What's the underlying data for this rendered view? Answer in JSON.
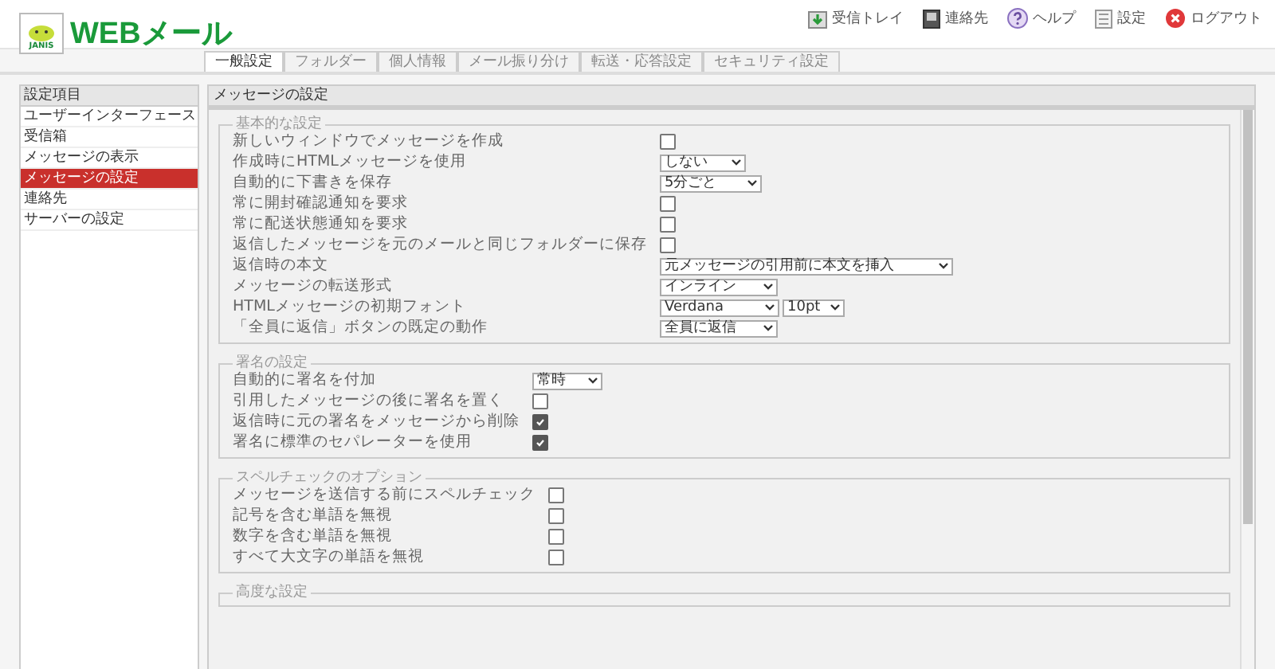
{
  "logo": {
    "badge": "JANIS",
    "title": "WEBメール"
  },
  "toolbar": [
    {
      "kind": "inbox",
      "label": "受信トレイ"
    },
    {
      "kind": "contacts",
      "label": "連絡先"
    },
    {
      "kind": "help",
      "label": "ヘルプ"
    },
    {
      "kind": "settings",
      "label": "設定"
    },
    {
      "kind": "logout",
      "label": "ログアウト"
    }
  ],
  "tabs": [
    {
      "label": "一般設定",
      "selected": true
    },
    {
      "label": "フォルダー",
      "selected": false
    },
    {
      "label": "個人情報",
      "selected": false
    },
    {
      "label": "メール振り分け",
      "selected": false
    },
    {
      "label": "転送・応答設定",
      "selected": false
    },
    {
      "label": "セキュリティ設定",
      "selected": false
    }
  ],
  "sidebar": {
    "title": "設定項目",
    "items": [
      {
        "label": "ユーザーインターフェース",
        "selected": false
      },
      {
        "label": "受信箱",
        "selected": false
      },
      {
        "label": "メッセージの表示",
        "selected": false
      },
      {
        "label": "メッセージの設定",
        "selected": true
      },
      {
        "label": "連絡先",
        "selected": false
      },
      {
        "label": "サーバーの設定",
        "selected": false
      }
    ]
  },
  "panel": {
    "title": "メッセージの設定",
    "sections": [
      {
        "legend": "基本的な設定",
        "rows": [
          {
            "kind": "checkbox",
            "label": "新しいウィンドウでメッセージを作成",
            "checked": false
          },
          {
            "kind": "select",
            "label": "作成時にHTMLメッセージを使用",
            "values": [
              "しない"
            ]
          },
          {
            "kind": "select",
            "label": "自動的に下書きを保存",
            "values": [
              "5分ごと"
            ]
          },
          {
            "kind": "checkbox",
            "label": "常に開封確認通知を要求",
            "checked": false
          },
          {
            "kind": "checkbox",
            "label": "常に配送状態通知を要求",
            "checked": false
          },
          {
            "kind": "checkbox",
            "label": "返信したメッセージを元のメールと同じフォルダーに保存",
            "checked": false
          },
          {
            "kind": "select",
            "label": "返信時の本文",
            "values": [
              "元メッセージの引用前に本文を挿入"
            ]
          },
          {
            "kind": "select",
            "label": "メッセージの転送形式",
            "values": [
              "インライン"
            ]
          },
          {
            "kind": "select",
            "label": "HTMLメッセージの初期フォント",
            "values": [
              "Verdana",
              "10pt"
            ]
          },
          {
            "kind": "select",
            "label": "「全員に返信」ボタンの既定の動作",
            "values": [
              "全員に返信"
            ]
          }
        ]
      },
      {
        "legend": "署名の設定",
        "rows": [
          {
            "kind": "select",
            "label": "自動的に署名を付加",
            "values": [
              "常時"
            ]
          },
          {
            "kind": "checkbox",
            "label": "引用したメッセージの後に署名を置く",
            "checked": false
          },
          {
            "kind": "checkbox",
            "label": "返信時に元の署名をメッセージから削除",
            "checked": true
          },
          {
            "kind": "checkbox",
            "label": "署名に標準のセパレーターを使用",
            "checked": true
          }
        ]
      },
      {
        "legend": "スペルチェックのオプション",
        "rows": [
          {
            "kind": "checkbox",
            "label": "メッセージを送信する前にスペルチェック",
            "checked": false
          },
          {
            "kind": "checkbox",
            "label": "記号を含む単語を無視",
            "checked": false
          },
          {
            "kind": "checkbox",
            "label": "数字を含む単語を無視",
            "checked": false
          },
          {
            "kind": "checkbox",
            "label": "すべて大文字の単語を無視",
            "checked": false
          }
        ]
      },
      {
        "legend": "高度な設定"
      }
    ]
  }
}
